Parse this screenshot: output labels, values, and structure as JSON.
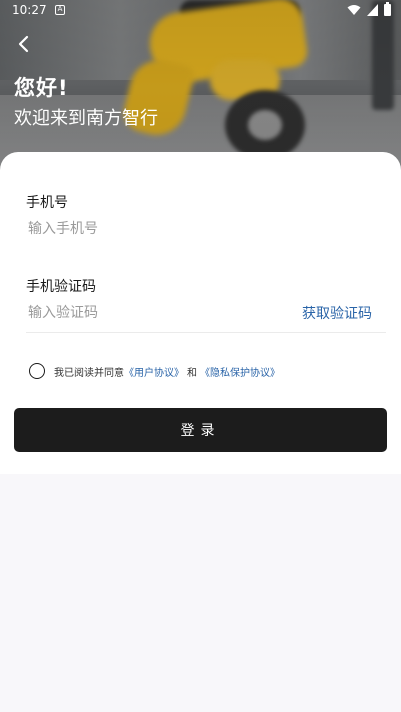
{
  "status_bar": {
    "time": "10:27",
    "notification_badge": "A",
    "icons": [
      "wifi-icon",
      "signal-icon",
      "battery-icon"
    ]
  },
  "header": {
    "back_icon": "chevron-left-icon",
    "title": "您好!",
    "subtitle": "欢迎来到南方智行"
  },
  "form": {
    "phone": {
      "label": "手机号",
      "placeholder": "输入手机号",
      "value": ""
    },
    "code": {
      "label": "手机验证码",
      "placeholder": "输入验证码",
      "value": "",
      "get_code_label": "获取验证码"
    },
    "agreement": {
      "checked": false,
      "prefix": "我已阅读并同意",
      "user_agreement": "《用户协议》",
      "and": "和",
      "privacy_policy": "《隐私保护协议》"
    },
    "login_label": "登录"
  },
  "colors": {
    "primary_button": "#1c1c1c",
    "link": "#2a64a8",
    "background": "#f8f7fa"
  }
}
